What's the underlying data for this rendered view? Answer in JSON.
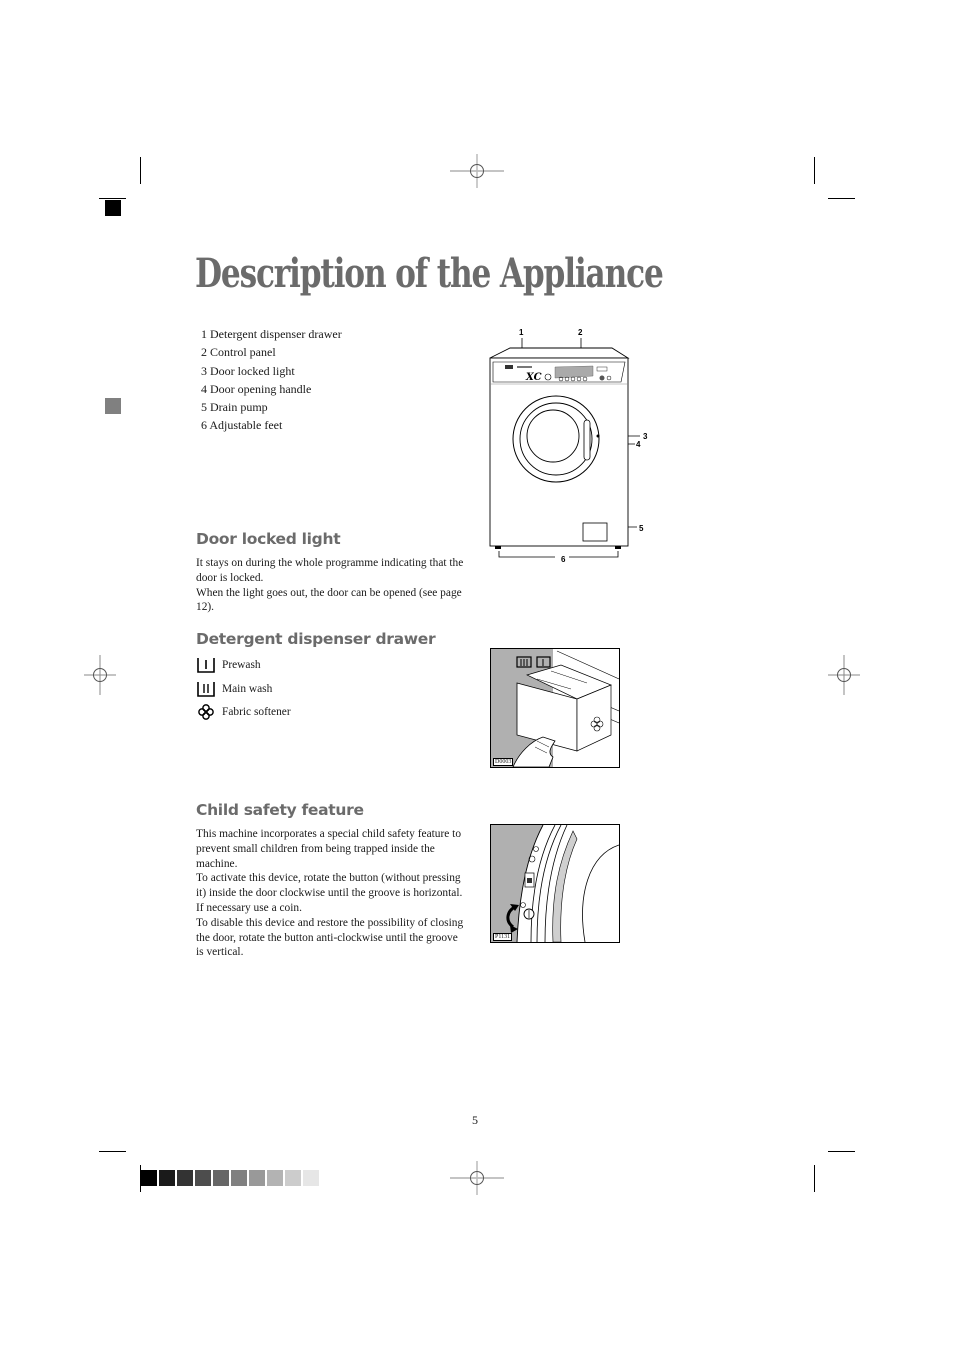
{
  "page": {
    "title": "Description of the Appliance",
    "page_number": "5"
  },
  "parts": [
    {
      "number": "1",
      "label": "Detergent dispenser drawer"
    },
    {
      "number": "2",
      "label": "Control panel"
    },
    {
      "number": "3",
      "label": "Door locked light"
    },
    {
      "number": "4",
      "label": "Door opening handle"
    },
    {
      "number": "5",
      "label": "Drain pump"
    },
    {
      "number": "6",
      "label": "Adjustable feet"
    }
  ],
  "appliance_figure": {
    "callouts": [
      "1",
      "2",
      "3",
      "4",
      "5",
      "6"
    ],
    "brand_mark": "XC"
  },
  "door_locked_light": {
    "heading": "Door locked light",
    "paragraphs": [
      "It stays on during the whole programme indicating that the door is locked.",
      "When the light goes out, the door can be opened (see page 12)."
    ]
  },
  "dispenser_drawer": {
    "heading": "Detergent dispenser drawer",
    "items": [
      {
        "icon": "prewash-compartment-icon",
        "label": "Prewash"
      },
      {
        "icon": "main-wash-compartment-icon",
        "label": "Main wash"
      },
      {
        "icon": "fabric-softener-flower-icon",
        "label": "Fabric softener"
      }
    ],
    "figure_code": "D0003"
  },
  "child_safety": {
    "heading": "Child safety feature",
    "paragraphs": [
      "This machine incorporates a special child safety feature to prevent small children from being trapped inside the machine.",
      "To activate this device, rotate the button (without pressing it) inside the door clockwise until the groove is horizontal. If necessary use a coin.",
      "To disable this device and restore the possibility of closing the door, rotate the button anti-clockwise until the groove is vertical."
    ],
    "figure_code": "P1131"
  },
  "print_marks": {
    "color_bar": [
      "#000000",
      "#1a1a1a",
      "#333333",
      "#4d4d4d",
      "#666666",
      "#808080",
      "#999999",
      "#b3b3b3",
      "#cccccc",
      "#e6e6e6"
    ],
    "corner_square_color": "#000000",
    "side_square_color": "#808080"
  }
}
